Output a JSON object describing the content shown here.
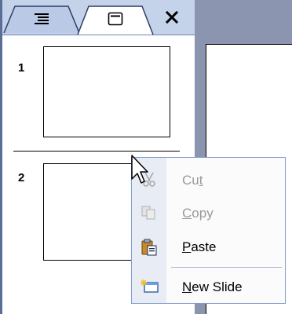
{
  "tabs": {
    "outline_icon": "outline-lines-icon",
    "slides_icon": "slide-thumbnail-icon",
    "close_label": "×"
  },
  "slides": [
    {
      "number": "1"
    },
    {
      "number": "2"
    }
  ],
  "context_menu": {
    "items": [
      {
        "pre": "Cu",
        "key": "t",
        "post": "",
        "enabled": false,
        "icon": "scissors-icon"
      },
      {
        "pre": "",
        "key": "C",
        "post": "opy",
        "enabled": false,
        "icon": "copy-icon"
      },
      {
        "pre": "",
        "key": "P",
        "post": "aste",
        "enabled": true,
        "icon": "paste-clipboard-icon"
      },
      {
        "pre": "",
        "key": "N",
        "post": "ew Slide",
        "enabled": true,
        "icon": "new-slide-icon"
      }
    ]
  },
  "colors": {
    "tab_bg": "#c5d3ea",
    "workspace": "#8c95b0",
    "menu_border": "#7f9bd0",
    "disabled_text": "#9a9a9a"
  }
}
